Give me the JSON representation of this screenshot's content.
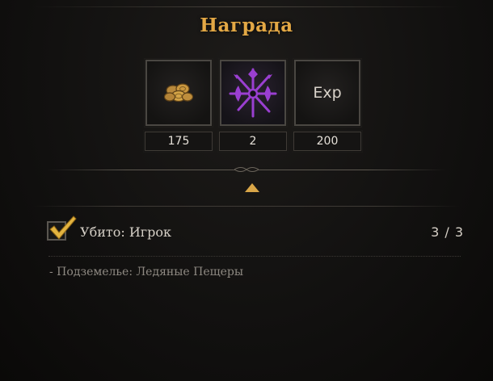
{
  "title": "Награда",
  "rewards": [
    {
      "icon": "gold-coins-icon",
      "count": "175"
    },
    {
      "icon": "purple-weapons-emblem-icon",
      "count": "2"
    },
    {
      "icon": "exp-icon",
      "label": "Exp",
      "count": "200"
    }
  ],
  "objective": {
    "text": "Убито: Игрок",
    "progress": "3 / 3",
    "completed": true
  },
  "location_text": "- Подземелье: Ледяные Пещеры",
  "colors": {
    "title_gold": "#e3a845",
    "check_gold": "#e2b340",
    "emblem_purple": "#9a3fd1"
  }
}
